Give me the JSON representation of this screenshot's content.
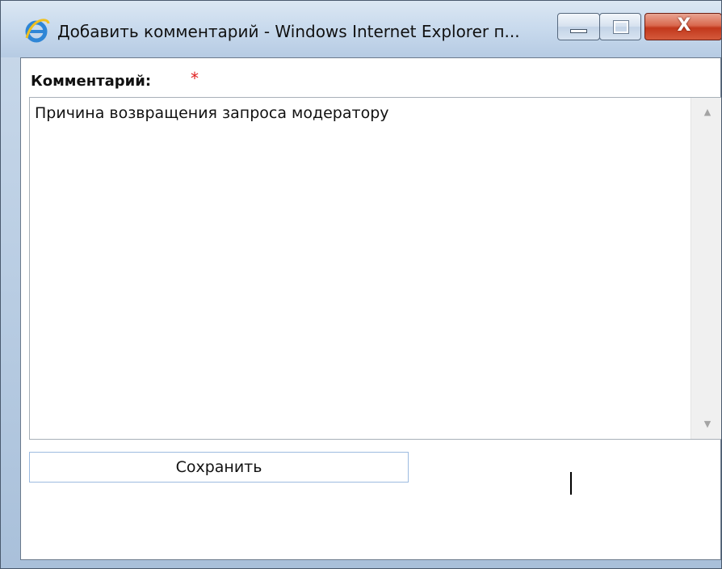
{
  "window": {
    "title": "Добавить комментарий - Windows Internet Explorer п...",
    "app_icon": "ie-icon",
    "caption_buttons": {
      "minimize_icon": "minimize-icon",
      "maximize_icon": "maximize-icon",
      "close_icon": "close-icon",
      "close_glyph": "X"
    }
  },
  "form": {
    "comment_label": "Комментарий:",
    "required_mark": "*",
    "comment_value": "Причина возвращения запроса модератору",
    "save_label": "Сохранить"
  },
  "scrollbar": {
    "up_glyph": "▲",
    "down_glyph": "▼"
  },
  "colors": {
    "required": "#e02020",
    "close_button": "#c2381c",
    "button_border": "#9dbbe0"
  }
}
